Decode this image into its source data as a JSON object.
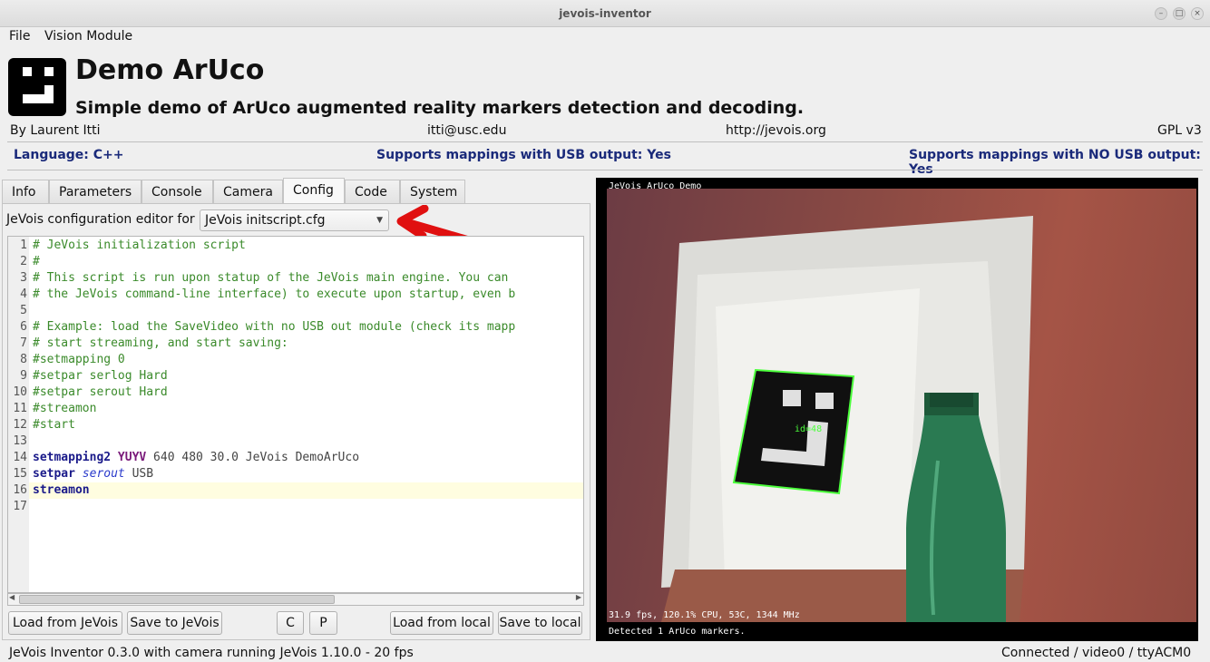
{
  "window": {
    "title": "jevois-inventor"
  },
  "menubar": {
    "file": "File",
    "vision_module": "Vision Module"
  },
  "header": {
    "title": "Demo ArUco",
    "subtitle": "Simple demo of ArUco augmented reality markers detection and decoding.",
    "author": "By Laurent Itti",
    "email": "itti@usc.edu",
    "url": "http://jevois.org",
    "license": "GPL v3",
    "language": "Language: C++",
    "usb_output": "Supports mappings with USB output: Yes",
    "no_usb_output": "Supports mappings with NO USB output: Yes"
  },
  "tabs": [
    {
      "label": "Info",
      "active": false
    },
    {
      "label": "Parameters",
      "active": false
    },
    {
      "label": "Console",
      "active": false
    },
    {
      "label": "Camera",
      "active": false
    },
    {
      "label": "Config",
      "active": true
    },
    {
      "label": "Code",
      "active": false
    },
    {
      "label": "System",
      "active": false
    }
  ],
  "editor": {
    "label": "JeVois configuration editor for",
    "selected_file": "JeVois initscript.cfg",
    "line_numbers": [
      "1",
      "2",
      "3",
      "4",
      "5",
      "6",
      "7",
      "8",
      "9",
      "10",
      "11",
      "12",
      "13",
      "14",
      "15",
      "16",
      "17"
    ],
    "lines": [
      "# JeVois initialization script",
      "#",
      "# This script is run upon statup of the JeVois main engine. You can",
      "# the JeVois command-line interface) to execute upon startup, even b",
      "",
      "# Example: load the SaveVideo with no USB out module (check its mapp",
      "# start streaming, and start saving:",
      "#setmapping 0",
      "#setpar serlog Hard",
      "#setpar serout Hard",
      "#streamon",
      "#start",
      "",
      {
        "cmd": "setmapping2",
        "type": "YUYV",
        "rest": " 640 480 30.0 JeVois DemoArUco"
      },
      {
        "cmd": "setpar",
        "param": "serout",
        "rest": " USB"
      },
      {
        "cmd": "streamon"
      },
      ""
    ]
  },
  "buttons": {
    "load_from_jevois": "Load from JeVois",
    "save_to_jevois": "Save to JeVois",
    "c": "C",
    "p": "P",
    "load_from_local": "Load from local",
    "save_to_local": "Save to local"
  },
  "video": {
    "overlay_title": "JeVois ArUco Demo",
    "marker_label": "id=48",
    "stats": "31.9 fps, 120.1% CPU, 53C, 1344 MHz",
    "detected": "Detected 1 ArUco markers."
  },
  "statusbar": {
    "left": "JeVois Inventor 0.3.0 with camera running JeVois 1.10.0 - 20 fps",
    "right": "Connected / video0 / ttyACM0"
  },
  "colors": {
    "accent_blue": "#1a2a7a",
    "comment_green": "#3a8a2a",
    "marker_green": "#4cff3c",
    "annotation_red": "#e01010"
  }
}
